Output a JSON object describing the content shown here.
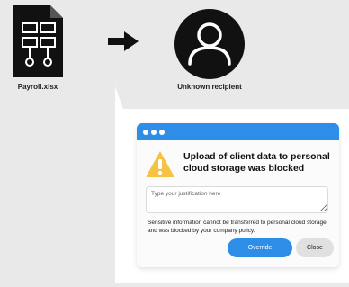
{
  "file": {
    "name": "Payroll.xlsx",
    "icon": "spreadsheet-file-icon"
  },
  "transfer": {
    "icon": "arrow-right-icon"
  },
  "recipient": {
    "label": "Unknown recipient",
    "icon": "user-avatar-icon"
  },
  "dialog": {
    "title": "Upload of client data to personal cloud storage was blocked",
    "warning_icon": "warning-triangle-icon",
    "justification_placeholder": "Type your justification here",
    "justification_value": "",
    "message": "Sensitive information cannot be transferred to personal cloud storage and was blocked by your company policy.",
    "override_label": "Override",
    "close_label": "Close"
  },
  "colors": {
    "accent": "#2e8de6",
    "warning": "#f5c242",
    "background": "#e9e9e9",
    "icon_dark": "#111111"
  }
}
